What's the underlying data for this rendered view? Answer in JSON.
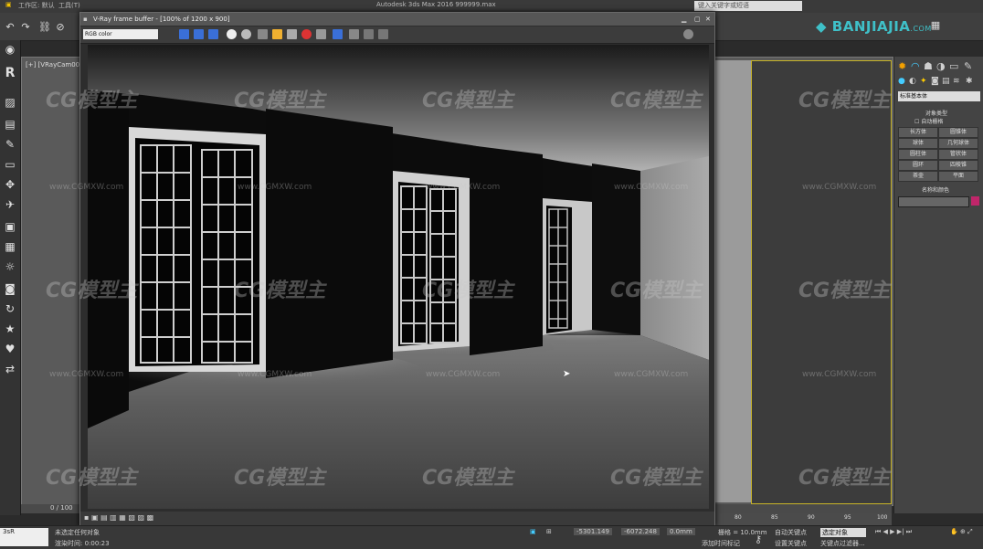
{
  "app": {
    "title": "Autodesk 3ds Max 2016    999999.max",
    "menu": [
      "工作区: 默认",
      "工具(T)"
    ],
    "search_placeholder": "键入关键字或短语",
    "logo": "BANJIAJIA",
    "logo_suffix": ".COM"
  },
  "viewport": {
    "label": "[+] [VRayCam001] [真实]"
  },
  "vfb": {
    "title": "V-Ray frame buffer - [100% of 1200 x 900]",
    "channel": "RGB color"
  },
  "command_panel": {
    "dropdown": "标准基本体",
    "rollout_title": "对象类型",
    "autogrid": "自动栅格",
    "buttons": [
      "长方体",
      "圆锥体",
      "球体",
      "几何球体",
      "圆柱体",
      "管状体",
      "圆环",
      "四棱锥",
      "茶壶",
      "平面"
    ],
    "name_color_title": "名称和颜色",
    "swatch_color": "#c0266a"
  },
  "timeline": {
    "frame": "0 / 100",
    "ticks": [
      "80",
      "85",
      "90",
      "95",
      "100"
    ]
  },
  "status": {
    "line1": "未选定任何对象",
    "line2": "渲染时间: 0:00:23",
    "x": "-5301.149",
    "y": "-6072.248",
    "z": "0.0mm",
    "grid": "栅格 = 10.0mm",
    "autokey": "自动关键点",
    "selection": "选定对象",
    "setkey": "设置关键点",
    "filters": "关键点过滤器...",
    "add_time_tag": "添加时间标记",
    "left_box": "3sR"
  },
  "watermark": {
    "brand": "CG模型主",
    "url": "www.CGMXW.com"
  },
  "colors": {
    "accent_yellow": "#c8b428",
    "logo_cyan": "#3fc0c8",
    "ui_dark": "#2b2b2b"
  }
}
